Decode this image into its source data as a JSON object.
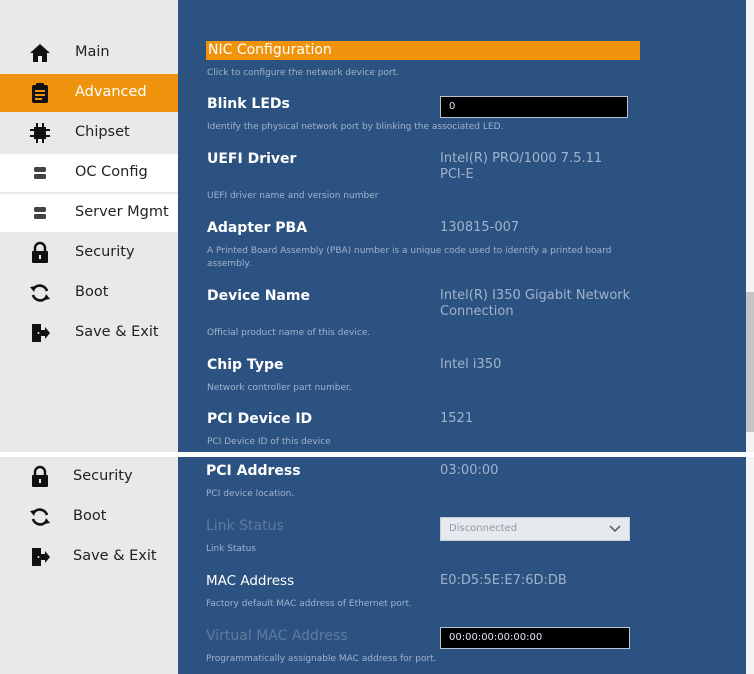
{
  "sidebar_top": {
    "items": [
      {
        "label": "Main",
        "icon": "home-icon"
      },
      {
        "label": "Advanced",
        "icon": "clipboard-icon"
      },
      {
        "label": "Chipset",
        "icon": "chip-icon"
      },
      {
        "label": "OC Config",
        "icon": "server-icon"
      },
      {
        "label": "Server Mgmt",
        "icon": "server-icon"
      },
      {
        "label": "Security",
        "icon": "lock-icon"
      },
      {
        "label": "Boot",
        "icon": "refresh-icon"
      },
      {
        "label": "Save & Exit",
        "icon": "exit-icon"
      }
    ],
    "active": "Advanced"
  },
  "sidebar_bottom": {
    "items": [
      {
        "label": "Security",
        "icon": "lock-icon"
      },
      {
        "label": "Boot",
        "icon": "refresh-icon"
      },
      {
        "label": "Save & Exit",
        "icon": "exit-icon"
      }
    ]
  },
  "main": {
    "header": "NIC Configuration",
    "header_help": "Click to configure the network device port.",
    "blink_leds": {
      "label": "Blink LEDs",
      "value": "0",
      "help": "Identify the physical network port by blinking the associated LED."
    },
    "uefi_driver": {
      "label": "UEFI Driver",
      "value_line1": "Intel(R) PRO/1000 7.5.11",
      "value_line2": "PCI-E",
      "help": "UEFI driver name and version number"
    },
    "adapter_pba": {
      "label": "Adapter PBA",
      "value": "130815-007",
      "help": "A Printed Board Assembly (PBA) number is a unique code used to identify a printed board assembly."
    },
    "device_name": {
      "label": "Device Name",
      "value_line1": "Intel(R) I350 Gigabit Network",
      "value_line2": "Connection",
      "help": "Official product name of this device."
    },
    "chip_type": {
      "label": "Chip Type",
      "value": "Intel i350",
      "help": "Network controller part number."
    },
    "pci_device_id": {
      "label": "PCI Device ID",
      "value": "1521",
      "help": "PCI Device ID of this device"
    }
  },
  "main_bottom": {
    "pci_address": {
      "label": "PCI Address",
      "value": "03:00:00",
      "help": "PCI device location."
    },
    "link_status": {
      "label": "Link Status",
      "value": "Disconnected",
      "help": "Link Status"
    },
    "mac_address": {
      "label": "MAC Address",
      "value": "E0:D5:5E:E7:6D:DB",
      "help": "Factory default MAC address of Ethernet port."
    },
    "virtual_mac": {
      "label": "Virtual MAC Address",
      "value": "00:00:00:00:00:00",
      "help": "Programmatically assignable MAC address for port."
    }
  },
  "colors": {
    "accent": "#f0930c",
    "panel_blue": "#2c5282",
    "sidebar_gray": "#e9e9e9"
  }
}
